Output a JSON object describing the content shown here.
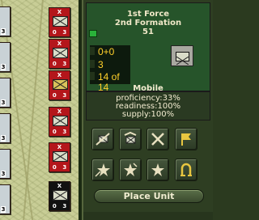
{
  "unit": {
    "name": "1st Force",
    "formation": "2nd Formation",
    "number": "51",
    "stat_a": "0+0",
    "stat_b": "3",
    "stat_c": "14 of 14",
    "movement_type": "Mobile",
    "proficiency": "proficiency:33%",
    "readiness": "readiness:100%",
    "supply": "supply:100%"
  },
  "actions": {
    "place_unit_label": "Place Unit",
    "buttons": [
      {
        "icon": "disband-icon"
      },
      {
        "icon": "transfer-icon"
      },
      {
        "icon": "attack-icon"
      },
      {
        "icon": "flag-icon"
      },
      {
        "icon": "move-star-icon"
      },
      {
        "icon": "promote-star-icon"
      },
      {
        "icon": "star-icon"
      },
      {
        "icon": "undo-icon"
      }
    ]
  },
  "map_counters": [
    {
      "tag": "X",
      "top": "0",
      "bottom": "3",
      "color": "#b4161b"
    },
    {
      "tag": "X",
      "top": "0",
      "bottom": "3",
      "color": "#b4161b"
    },
    {
      "tag": "X",
      "top": "0",
      "bottom": "3",
      "color": "#b4161b",
      "symbol": "yellow"
    },
    {
      "tag": "X",
      "top": "0",
      "bottom": "3",
      "color": "#b4161b"
    },
    {
      "tag": "X",
      "top": "0",
      "bottom": "3",
      "color": "#b4161b"
    },
    {
      "tag": "X",
      "top": "0",
      "bottom": "3",
      "color": "#b4161b"
    },
    {
      "tag": "X",
      "top": "0",
      "bottom": "3",
      "color": "#111111"
    }
  ],
  "colors": {
    "info_bg": "#26542a",
    "stat_text": "#ffd02a",
    "label_text": "#f3ecd0"
  }
}
